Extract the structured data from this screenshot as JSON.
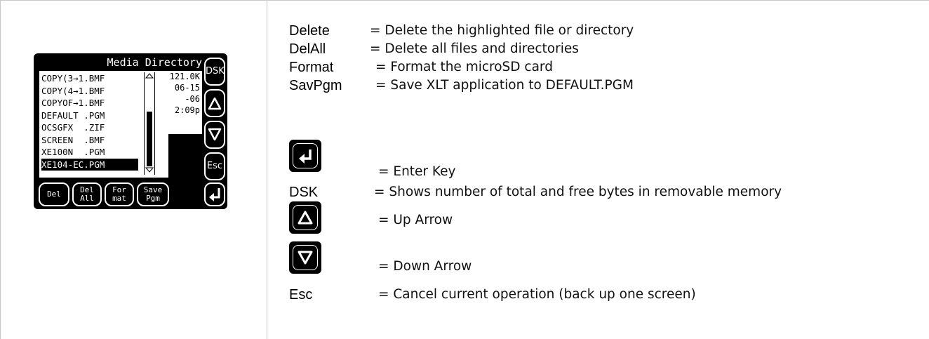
{
  "lcd": {
    "title": "Media Directory",
    "files": [
      "COPY(3→1.BMF",
      "COPY(4→1.BMF",
      "COPYOF→1.BMF",
      "DEFAULT .PGM",
      "OCSGFX  .ZIF",
      "SCREEN  .BMF",
      "XE100N  .PGM",
      "XE104-EC.PGM"
    ],
    "selected_index": 7,
    "info": [
      "121.0K",
      "06-15",
      "-06",
      "2:09p"
    ],
    "side_buttons": [
      "DSK",
      "Esc"
    ],
    "bottom_buttons": [
      {
        "line1": "Del",
        "line2": ""
      },
      {
        "line1": "Del",
        "line2": "All"
      },
      {
        "line1": "For",
        "line2": "mat"
      },
      {
        "line1": "Save",
        "line2": "Pgm"
      }
    ]
  },
  "legend": {
    "delete": {
      "term": "Delete",
      "desc": "= Delete the highlighted file or directory"
    },
    "delall": {
      "term": "DelAll",
      "desc": "= Delete all files and directories"
    },
    "format": {
      "term": "Format",
      "desc": "= Format the microSD card"
    },
    "savpgm": {
      "term": "SavPgm",
      "desc": "= Save XLT application to DEFAULT.PGM"
    },
    "enter": {
      "desc": "= Enter Key"
    },
    "dsk": {
      "term": "DSK",
      "desc": "= Shows number of total and free bytes in removable memory"
    },
    "up": {
      "desc": "= Up Arrow"
    },
    "down": {
      "desc": "= Down Arrow"
    },
    "esc": {
      "term": "Esc",
      "desc": "= Cancel current operation (back up one screen)"
    }
  }
}
